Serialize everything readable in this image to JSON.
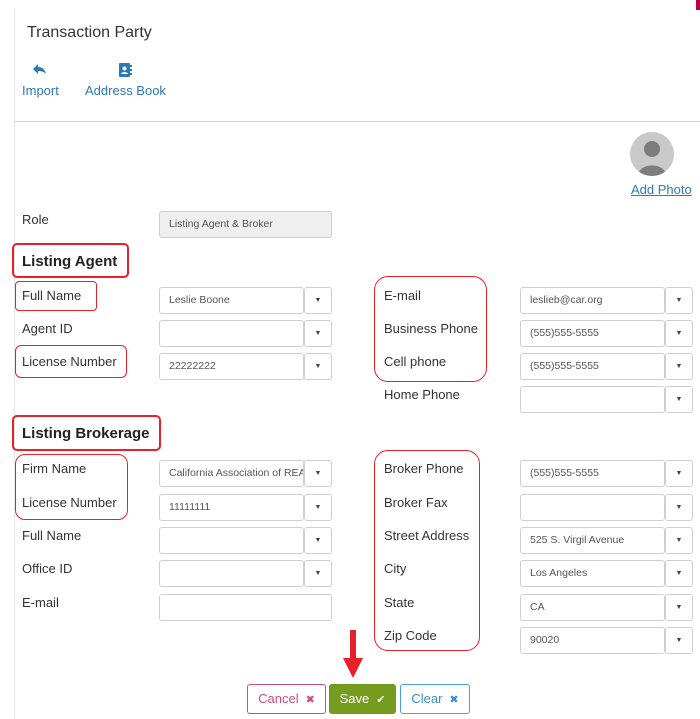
{
  "header": {
    "title": "Transaction Party"
  },
  "toolbar": {
    "import_label": "Import",
    "address_book_label": "Address Book"
  },
  "photo": {
    "add_photo_label": "Add Photo"
  },
  "role": {
    "label": "Role",
    "value": "Listing Agent & Broker"
  },
  "listing_agent": {
    "heading": "Listing Agent",
    "full_name_label": "Full Name",
    "full_name": "Leslie Boone",
    "agent_id_label": "Agent ID",
    "agent_id": "",
    "license_label": "License Number",
    "license": "22222222",
    "email_label": "E-mail",
    "email": "leslieb@car.org",
    "business_phone_label": "Business Phone",
    "business_phone": "(555)555-5555",
    "cell_phone_label": "Cell phone",
    "cell_phone": "(555)555-5555",
    "home_phone_label": "Home Phone",
    "home_phone": ""
  },
  "listing_brokerage": {
    "heading": "Listing Brokerage",
    "firm_name_label": "Firm Name",
    "firm_name": "California Association of REALTORS",
    "license_label": "License Number",
    "license": "11111111",
    "full_name_label": "Full Name",
    "full_name": "",
    "office_id_label": "Office ID",
    "office_id": "",
    "email_label": "E-mail",
    "email": "",
    "broker_phone_label": "Broker Phone",
    "broker_phone": "(555)555-5555",
    "broker_fax_label": "Broker Fax",
    "broker_fax": "",
    "street_label": "Street Address",
    "street": "525 S. Virgil Avenue",
    "city_label": "City",
    "city": "Los Angeles",
    "state_label": "State",
    "state": "CA",
    "zip_label": "Zip Code",
    "zip": "90020"
  },
  "footer": {
    "cancel_label": "Cancel",
    "save_label": "Save",
    "clear_label": "Clear"
  },
  "colors": {
    "link": "#2a7ab8",
    "highlight": "#e8202a",
    "save": "#759b1f",
    "cancel": "#d24a7b",
    "clear": "#3a8fcb"
  },
  "icons": {
    "import": "reply-arrow-icon",
    "address_book": "address-book-icon",
    "dropdown": "caret-down-icon",
    "save": "check-icon",
    "cancel": "x-icon",
    "clear": "x-icon"
  }
}
